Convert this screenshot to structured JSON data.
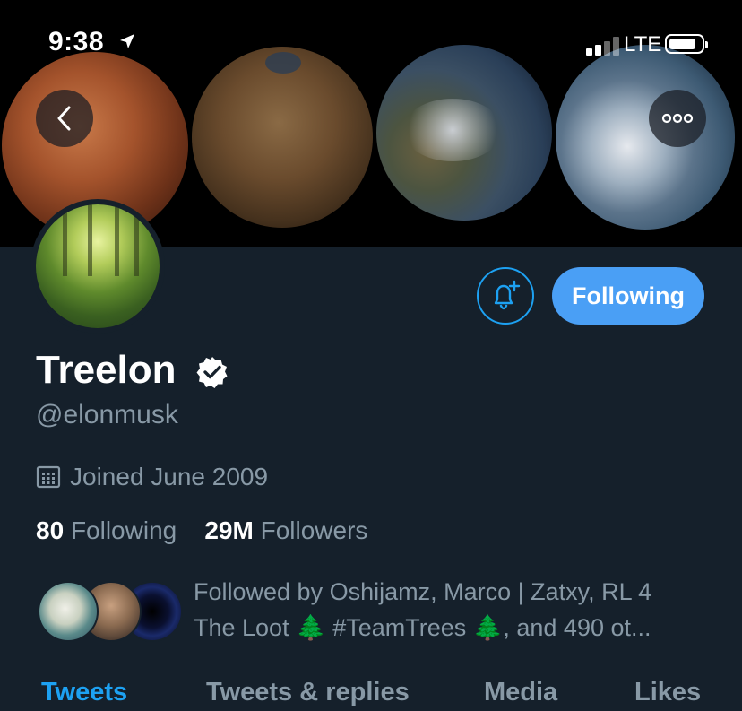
{
  "status_bar": {
    "time": "9:38",
    "network": "LTE",
    "icons": [
      "location-arrow-icon",
      "signal-bars-icon",
      "battery-icon"
    ]
  },
  "header": {
    "back_icon": "chevron-left-icon",
    "more_icon": "more-dots-icon"
  },
  "profile": {
    "name": "Treelon",
    "handle": "@elonmusk",
    "joined": "Joined June 2009",
    "following_count": "80",
    "following_label": "Following",
    "followers_count": "29M",
    "followers_label": "Followers",
    "followed_by_line1": "Followed by Oshijamz, Marco | Zatxy, RL 4",
    "followed_by_line2": "The Loot 🌲 #TeamTrees 🌲, and 490 ot..."
  },
  "actions": {
    "notify_icon": "bell-plus-icon",
    "following_button": "Following"
  },
  "tabs": [
    {
      "label": "Tweets",
      "active": true
    },
    {
      "label": "Tweets & replies",
      "active": false
    },
    {
      "label": "Media",
      "active": false
    },
    {
      "label": "Likes",
      "active": false
    }
  ],
  "colors": {
    "background": "#15202b",
    "accent": "#1da1f2",
    "button": "#4a9ff5",
    "secondary_text": "#8899a6"
  }
}
